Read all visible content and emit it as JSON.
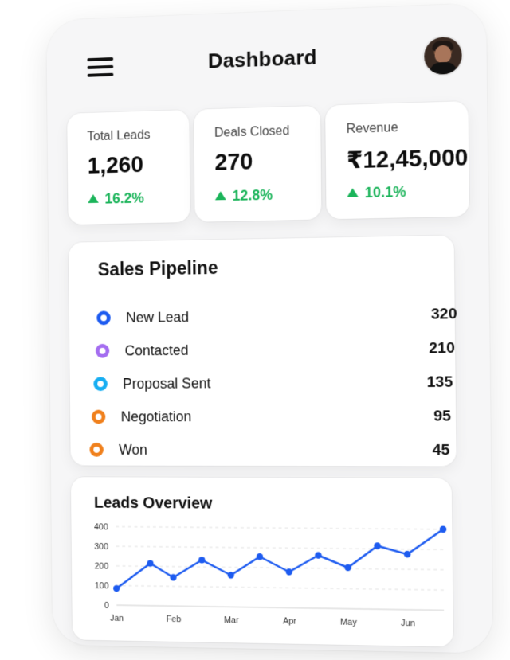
{
  "header": {
    "title": "Dashboard"
  },
  "kpis": [
    {
      "label": "Total Leads",
      "value": "1,260",
      "delta": "16.2%"
    },
    {
      "label": "Deals Closed",
      "value": "270",
      "delta": "12.8%"
    },
    {
      "label": "Revenue",
      "value": "₹12,45,000",
      "delta": "10.1%"
    }
  ],
  "pipeline": {
    "title": "Sales Pipeline",
    "items": [
      {
        "label": "New Lead",
        "count": "320",
        "color": "#1d5bf0"
      },
      {
        "label": "Contacted",
        "count": "210",
        "color": "#a46df0"
      },
      {
        "label": "Proposal Sent",
        "count": "135",
        "color": "#17aef2"
      },
      {
        "label": "Negotiation",
        "count": "95",
        "color": "#f0801c"
      },
      {
        "label": "Won",
        "count": "45",
        "color": "#f0801c"
      }
    ]
  },
  "leads_overview": {
    "title": "Leads Overview"
  },
  "chart_data": {
    "type": "line",
    "title": "Leads Overview",
    "xlabel": "",
    "ylabel": "",
    "categories": [
      "Jan",
      "Feb",
      "Mar",
      "Apr",
      "May",
      "Jun"
    ],
    "ylim": [
      0,
      400
    ],
    "yticks": [
      0,
      100,
      200,
      300,
      400
    ],
    "grid": true,
    "series": [
      {
        "color": "#1d5bf0",
        "x": [
          0,
          0.6,
          1.0,
          1.5,
          2.0,
          2.5,
          3.0,
          3.5,
          4.0,
          4.5,
          5.0,
          5.6
        ],
        "values": [
          85,
          215,
          145,
          235,
          160,
          255,
          180,
          265,
          205,
          315,
          275,
          400
        ]
      }
    ]
  }
}
